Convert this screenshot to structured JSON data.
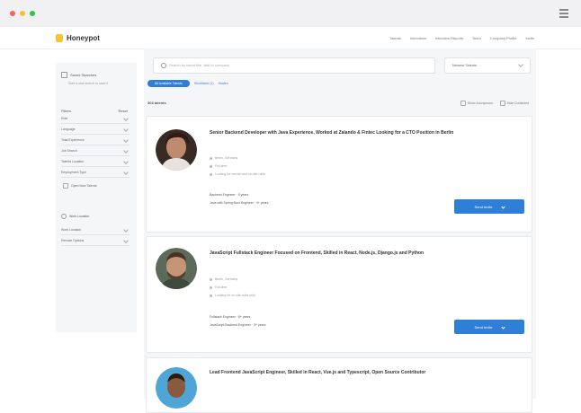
{
  "window": {
    "controls": [
      "close",
      "minimize",
      "maximize"
    ],
    "menu_icon": "hamburger-icon"
  },
  "brand": {
    "name": "Honeypot",
    "color": "#f6c238"
  },
  "nav": {
    "links": [
      "Talents",
      "Interviews",
      "Interview Reports",
      "Team",
      "Company Profile",
      "Invite"
    ]
  },
  "sidebar": {
    "saved_search": {
      "label": "Saved Searches",
      "sub": "Start a new search to save it"
    },
    "filters": {
      "label": "Filters",
      "reset": "Reset"
    },
    "items": [
      "Role",
      "Language",
      "Total Experience",
      "Job Search",
      "Talents Location",
      "Employment Type"
    ],
    "check": "Open Now Talents",
    "locations": {
      "label": "Work Location",
      "items": [
        "Work Location",
        "Remote Options"
      ]
    }
  },
  "search": {
    "placeholder": "Search by talent title, skill or company",
    "sort": "Newest Talents"
  },
  "tabs": [
    "All Available Talents",
    "Shortlisted (1)",
    "Hidden"
  ],
  "results": {
    "count": "304 talents",
    "options": [
      "Show Anonymous",
      "Hide Contacted"
    ]
  },
  "cards": [
    {
      "title": "Senior Backend Developer with Java Experience, Worked at Zalando & Fintec Looking for a CTO Position in Berlin",
      "meta": [
        "Berlin, Germany",
        "Full-time",
        "Looking for remote and on-site roles"
      ],
      "exp": [
        "Backend Engineer · 5 years",
        "Java with Spring Boot Engineer · 4+ years"
      ],
      "button": "Send Invite"
    },
    {
      "title": "JavaScript Fullstack Engineer Focused on Frontend, Skilled in React, Node.js, Django.js and Python",
      "meta": [
        "Berlin, Germany",
        "Full-time",
        "Looking for on-site roles only"
      ],
      "exp": [
        "Fullstack Engineer · 5+ years",
        "JavaScript Backend Engineer · 3+ years"
      ],
      "button": "Send Invite"
    },
    {
      "title": "Lead Frontend JavaScript Engineer, Skilled in React, Vue.js and Typescript, Open Source Contributor",
      "meta": [],
      "exp": [],
      "button": ""
    }
  ],
  "colors": {
    "primary": "#2f7fd8",
    "background": "#f5f6f8"
  }
}
